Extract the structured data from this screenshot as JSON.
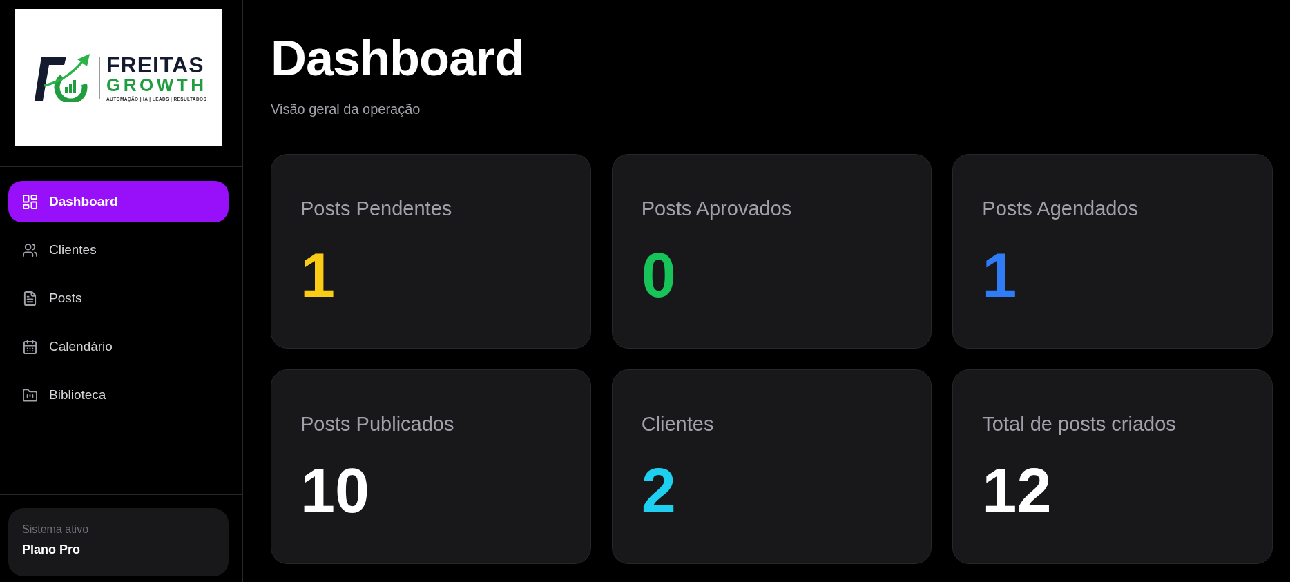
{
  "sidebar": {
    "logo": {
      "name_line_1": "FREITAS",
      "name_line_2": "GROWTH",
      "tagline": "AUTOMAÇÃO | IA | LEADS | RESULTADOS"
    },
    "nav_items": [
      {
        "label": "Dashboard",
        "selected": true
      },
      {
        "label": "Clientes",
        "selected": false
      },
      {
        "label": "Posts",
        "selected": false
      },
      {
        "label": "Calendário",
        "selected": false
      },
      {
        "label": "Biblioteca",
        "selected": false
      }
    ],
    "plan_card": {
      "caption": "Sistema ativo",
      "plan": "Plano Pro"
    }
  },
  "header": {
    "title": "Dashboard",
    "subtitle": "Visão geral da operação"
  },
  "stats": [
    {
      "label": "Posts Pendentes",
      "value": "1",
      "color": "#facc15"
    },
    {
      "label": "Posts Aprovados",
      "value": "0",
      "color": "#16c45a"
    },
    {
      "label": "Posts Agendados",
      "value": "1",
      "color": "#2f7cf6"
    },
    {
      "label": "Posts Publicados",
      "value": "10",
      "color": "#ffffff"
    },
    {
      "label": "Clientes",
      "value": "2",
      "color": "#1ecff0"
    },
    {
      "label": "Total de posts criados",
      "value": "12",
      "color": "#ffffff"
    }
  ]
}
